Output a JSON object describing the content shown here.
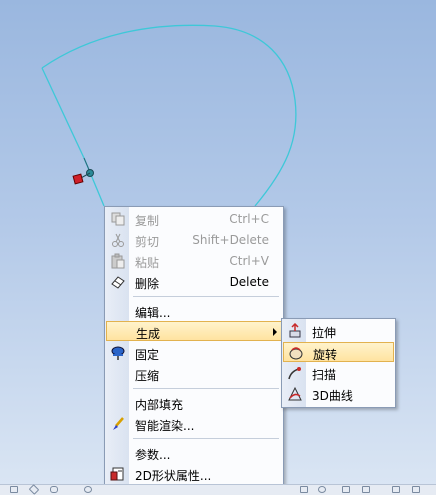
{
  "context_menu": {
    "items": [
      {
        "label": "复制",
        "shortcut": "Ctrl+C",
        "icon": "copy-icon",
        "enabled": false
      },
      {
        "label": "剪切",
        "shortcut": "Shift+Delete",
        "icon": "cut-icon",
        "enabled": false
      },
      {
        "label": "粘贴",
        "shortcut": "Ctrl+V",
        "icon": "paste-icon",
        "enabled": false
      },
      {
        "label": "删除",
        "shortcut": "Delete",
        "icon": "eraser-icon",
        "enabled": true
      },
      {
        "label": "编辑..."
      },
      {
        "label": "生成",
        "has_submenu": true,
        "highlighted": true
      },
      {
        "label": "固定",
        "icon": "pin-icon"
      },
      {
        "label": "压缩"
      },
      {
        "label": "内部填充"
      },
      {
        "label": "智能渲染...",
        "icon": "brush-icon"
      },
      {
        "label": "参数..."
      },
      {
        "label": "2D形状属性...",
        "icon": "properties-icon"
      }
    ]
  },
  "submenu": {
    "items": [
      {
        "label": "拉伸",
        "icon": "extrude-icon"
      },
      {
        "label": "旋转",
        "icon": "revolve-icon",
        "highlighted": true
      },
      {
        "label": "扫描",
        "icon": "sweep-icon"
      },
      {
        "label": "3D曲线",
        "icon": "3d-curve-icon"
      }
    ]
  },
  "colors": {
    "sketch_curve": "#3ec8d8",
    "highlight": "#ffe3a0",
    "selection_handle": "#d0202a"
  }
}
